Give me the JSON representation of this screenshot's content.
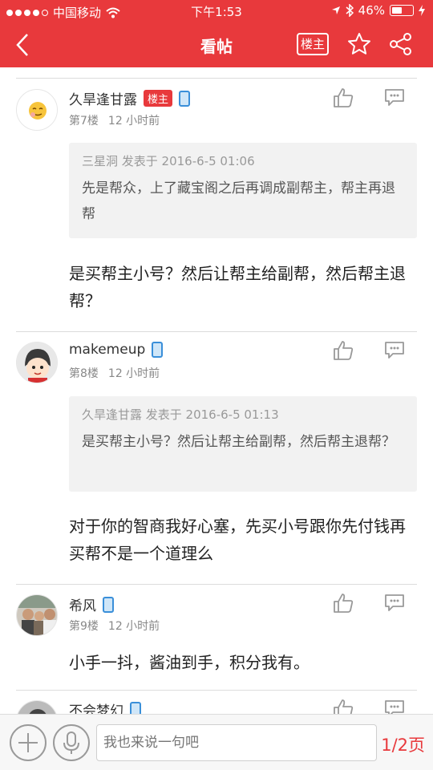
{
  "status_bar": {
    "carrier": "中国移动",
    "time": "下午1:53",
    "battery": "46%",
    "battery_level": 0.46
  },
  "navbar": {
    "title": "看帖",
    "host_button": "楼主"
  },
  "posts": [
    {
      "username": "久旱逢甘露",
      "tag": "楼主",
      "floor": "第7楼",
      "time": "12 小时前",
      "quote_header": "三星洞 发表于 2016-6-5 01:06",
      "quote_body": "先是帮众，上了藏宝阁之后再调成副帮主，帮主再退帮",
      "body": " 是买帮主小号？然后让帮主给副帮，然后帮主退帮？"
    },
    {
      "username": "makemeup",
      "floor": "第8楼",
      "time": "12 小时前",
      "quote_header": "久旱逢甘露 发表于 2016-6-5 01:13",
      "quote_body": "是买帮主小号？然后让帮主给副帮，然后帮主退帮？",
      "body": " 对于你的智商我好心塞，先买小号跟你先付钱再买帮不是一个道理么"
    },
    {
      "username": "希风",
      "floor": "第9楼",
      "time": "12 小时前",
      "body": "小手一抖，酱油到手，积分我有。"
    },
    {
      "username": "不会梦幻"
    }
  ],
  "bottom_bar": {
    "placeholder": "我也来说一句吧",
    "page": "1/2页"
  },
  "colors": {
    "accent": "#e8393c",
    "quote_bg": "#f2f2f2"
  }
}
